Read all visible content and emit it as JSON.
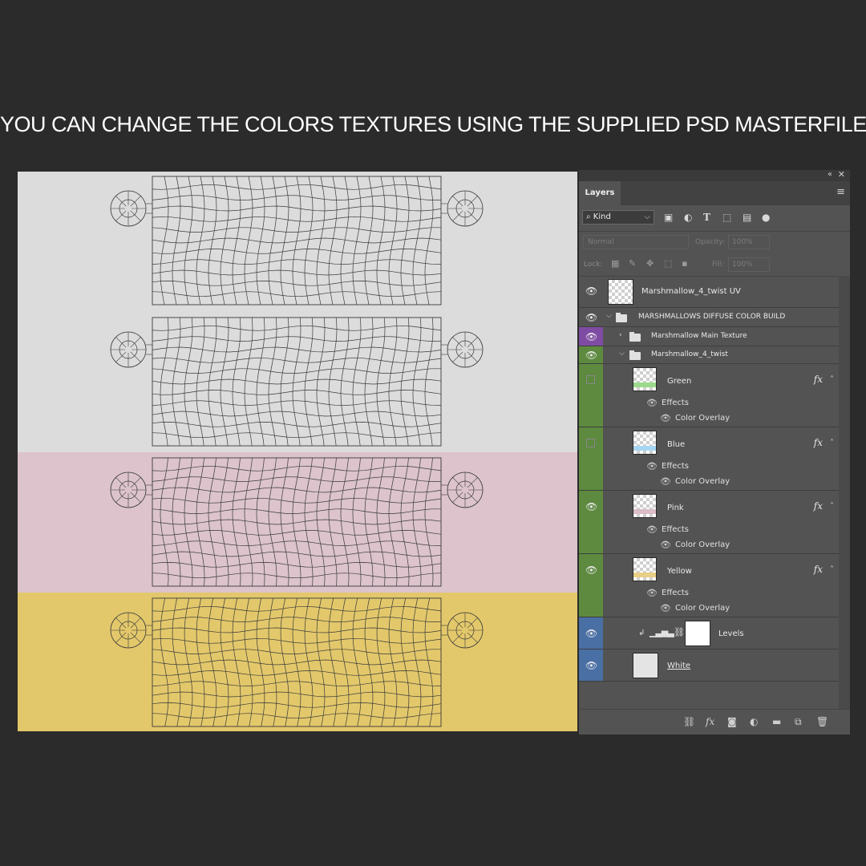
{
  "headline": "YOU CAN CHANGE THE COLORS TEXTURES USING THE SUPPLIED PSD MASTERFILE",
  "colors": {
    "page_bg": "#2b2b2b",
    "band_white": "#dcdcdc",
    "band_pink": "#dcc3cc",
    "band_yellow": "#e3c86b",
    "panel_bg": "#535353",
    "eye_col_purple": "#7f4ca3",
    "eye_col_green": "#5d8a3f",
    "eye_col_blue": "#4a6fa5",
    "swatch_green": "#9bd98b",
    "swatch_blue": "#a7d6f2",
    "swatch_pink": "#dcbcc6",
    "swatch_yellow": "#e8cf85"
  },
  "layers_panel": {
    "tab": "Layers",
    "filter": {
      "kind_label": "Kind",
      "icons": [
        "pixel-filter-icon",
        "adjustment-filter-icon",
        "type-filter-icon",
        "shape-filter-icon",
        "smart-object-filter-icon",
        "filter-toggle-icon"
      ]
    },
    "blend_mode": "Normal",
    "opacity_label": "Opacity:",
    "opacity_value": "100%",
    "lock_label": "Lock:",
    "fill_label": "Fill:",
    "fill_value": "100%",
    "layers": [
      {
        "name": "Marshmallow_4_twist UV",
        "visible": true
      },
      {
        "name": "MARSHMALLOWS DIFFUSE COLOR BUILD",
        "type": "group",
        "expanded": true
      },
      {
        "name": "Marshmallow Main Texture",
        "type": "group",
        "expanded": false
      },
      {
        "name": "Marshmallow_4_twist",
        "type": "group",
        "expanded": true
      },
      {
        "name": "Green",
        "visible": false,
        "effects_label": "Effects",
        "effect": "Color Overlay",
        "fx": "fx"
      },
      {
        "name": "Blue",
        "visible": false,
        "effects_label": "Effects",
        "effect": "Color Overlay",
        "fx": "fx"
      },
      {
        "name": "Pink",
        "visible": true,
        "effects_label": "Effects",
        "effect": "Color Overlay",
        "fx": "fx"
      },
      {
        "name": "Yellow",
        "visible": true,
        "effects_label": "Effects",
        "effect": "Color Overlay",
        "fx": "fx"
      },
      {
        "name": "Levels",
        "type": "adjustment"
      },
      {
        "name": "White",
        "visible": true
      }
    ],
    "footer_icons": [
      "link-layers-icon",
      "add-style-icon",
      "add-mask-icon",
      "new-adjustment-icon",
      "new-group-icon",
      "new-layer-icon",
      "delete-layer-icon"
    ]
  }
}
